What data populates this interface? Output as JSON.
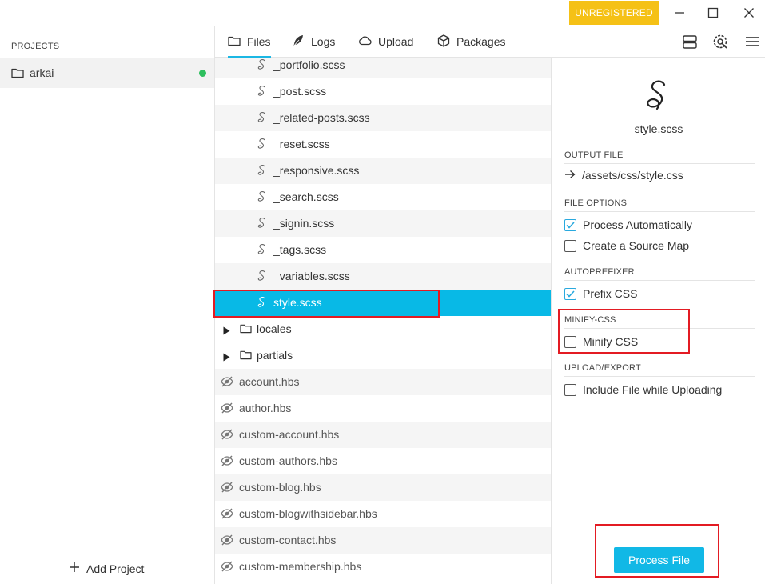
{
  "titlebar": {
    "unregistered_label": "UNREGISTERED",
    "minimize_icon": "minimize-icon",
    "maximize_icon": "maximize-icon",
    "close_icon": "close-icon"
  },
  "sidebar": {
    "heading": "PROJECTS",
    "projects": [
      {
        "name": "arkai",
        "status_color": "#2ebf5e"
      }
    ],
    "add_project_label": "Add Project"
  },
  "tabs": [
    {
      "label": "Files",
      "icon": "folder-icon",
      "active": true
    },
    {
      "label": "Logs",
      "icon": "feather-icon",
      "active": false
    },
    {
      "label": "Upload",
      "icon": "cloud-icon",
      "active": false
    },
    {
      "label": "Packages",
      "icon": "package-icon",
      "active": false
    }
  ],
  "toolbar": {
    "icons": [
      "server-icon",
      "settings-icon",
      "menu-icon"
    ]
  },
  "files": [
    {
      "name": "_portfolio.scss",
      "type": "sass"
    },
    {
      "name": "_post.scss",
      "type": "sass"
    },
    {
      "name": "_related-posts.scss",
      "type": "sass"
    },
    {
      "name": "_reset.scss",
      "type": "sass"
    },
    {
      "name": "_responsive.scss",
      "type": "sass"
    },
    {
      "name": "_search.scss",
      "type": "sass"
    },
    {
      "name": "_signin.scss",
      "type": "sass"
    },
    {
      "name": "_tags.scss",
      "type": "sass"
    },
    {
      "name": "_variables.scss",
      "type": "sass"
    },
    {
      "name": "style.scss",
      "type": "sass",
      "selected": true
    },
    {
      "name": "locales",
      "type": "folder"
    },
    {
      "name": "partials",
      "type": "folder"
    },
    {
      "name": "account.hbs",
      "type": "hidden"
    },
    {
      "name": "author.hbs",
      "type": "hidden"
    },
    {
      "name": "custom-account.hbs",
      "type": "hidden"
    },
    {
      "name": "custom-authors.hbs",
      "type": "hidden"
    },
    {
      "name": "custom-blog.hbs",
      "type": "hidden"
    },
    {
      "name": "custom-blogwithsidebar.hbs",
      "type": "hidden"
    },
    {
      "name": "custom-contact.hbs",
      "type": "hidden"
    },
    {
      "name": "custom-membership.hbs",
      "type": "hidden"
    }
  ],
  "panel": {
    "file_name": "style.scss",
    "output_heading": "OUTPUT FILE",
    "output_path": "/assets/css/style.css",
    "file_options_heading": "FILE OPTIONS",
    "process_automatically": {
      "label": "Process Automatically",
      "checked": true
    },
    "source_map": {
      "label": "Create a Source Map",
      "checked": false
    },
    "autoprefixer_heading": "AUTOPREFIXER",
    "prefix_css": {
      "label": "Prefix CSS",
      "checked": true
    },
    "minify_heading": "MINIFY-CSS",
    "minify_css": {
      "label": "Minify CSS",
      "checked": false
    },
    "upload_heading": "UPLOAD/EXPORT",
    "include_file": {
      "label": "Include File while Uploading",
      "checked": false
    },
    "process_button": "Process File"
  },
  "colors": {
    "accent": "#08b9e6",
    "unregistered_bg": "#f5c116",
    "highlight": "#e31b23",
    "status_green": "#2ebf5e"
  }
}
